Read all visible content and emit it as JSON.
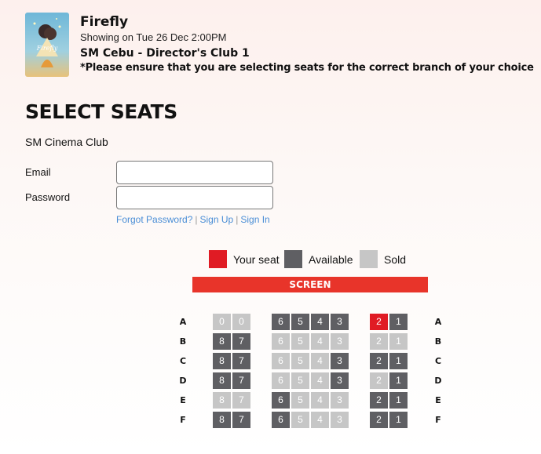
{
  "movie": {
    "title": "Firefly",
    "showing": "Showing on Tue 26 Dec 2:00PM",
    "branch": "SM Cebu - Director's Club 1",
    "warning": "*Please ensure that you are selecting seats for the correct branch of your choice",
    "poster_text": "Firefly"
  },
  "page": {
    "title": "SELECT SEATS",
    "club_label": "SM Cinema Club"
  },
  "login": {
    "email_label": "Email",
    "email_value": "",
    "password_label": "Password",
    "password_value": "",
    "forgot_label": "Forgot Password?",
    "signup_label": "Sign Up",
    "signin_label": "Sign In",
    "separator": "|"
  },
  "legend": {
    "your_seat": "Your seat",
    "available": "Available",
    "sold": "Sold"
  },
  "colors": {
    "your_seat": "#e01b24",
    "available": "#5f5f63",
    "sold": "#c6c6c6",
    "screen": "#e8342a",
    "link": "#4a8ed6"
  },
  "screen_label": "SCREEN",
  "seatmap": {
    "rows": [
      {
        "row": "A",
        "seats": [
          {
            "n": "0",
            "s": "sold"
          },
          {
            "n": "0",
            "s": "sold"
          },
          {
            "n": "6",
            "s": "available"
          },
          {
            "n": "5",
            "s": "available"
          },
          {
            "n": "4",
            "s": "available"
          },
          {
            "n": "3",
            "s": "available"
          },
          {
            "n": "2",
            "s": "selected"
          },
          {
            "n": "1",
            "s": "available"
          }
        ]
      },
      {
        "row": "B",
        "seats": [
          {
            "n": "8",
            "s": "available"
          },
          {
            "n": "7",
            "s": "available"
          },
          {
            "n": "6",
            "s": "sold"
          },
          {
            "n": "5",
            "s": "sold"
          },
          {
            "n": "4",
            "s": "sold"
          },
          {
            "n": "3",
            "s": "sold"
          },
          {
            "n": "2",
            "s": "sold"
          },
          {
            "n": "1",
            "s": "sold"
          }
        ]
      },
      {
        "row": "C",
        "seats": [
          {
            "n": "8",
            "s": "available"
          },
          {
            "n": "7",
            "s": "available"
          },
          {
            "n": "6",
            "s": "sold"
          },
          {
            "n": "5",
            "s": "sold"
          },
          {
            "n": "4",
            "s": "sold"
          },
          {
            "n": "3",
            "s": "available"
          },
          {
            "n": "2",
            "s": "available"
          },
          {
            "n": "1",
            "s": "available"
          }
        ]
      },
      {
        "row": "D",
        "seats": [
          {
            "n": "8",
            "s": "available"
          },
          {
            "n": "7",
            "s": "available"
          },
          {
            "n": "6",
            "s": "sold"
          },
          {
            "n": "5",
            "s": "sold"
          },
          {
            "n": "4",
            "s": "sold"
          },
          {
            "n": "3",
            "s": "available"
          },
          {
            "n": "2",
            "s": "sold"
          },
          {
            "n": "1",
            "s": "available"
          }
        ]
      },
      {
        "row": "E",
        "seats": [
          {
            "n": "8",
            "s": "sold"
          },
          {
            "n": "7",
            "s": "sold"
          },
          {
            "n": "6",
            "s": "available"
          },
          {
            "n": "5",
            "s": "sold"
          },
          {
            "n": "4",
            "s": "sold"
          },
          {
            "n": "3",
            "s": "sold"
          },
          {
            "n": "2",
            "s": "available"
          },
          {
            "n": "1",
            "s": "available"
          }
        ]
      },
      {
        "row": "F",
        "seats": [
          {
            "n": "8",
            "s": "available"
          },
          {
            "n": "7",
            "s": "available"
          },
          {
            "n": "6",
            "s": "available"
          },
          {
            "n": "5",
            "s": "sold"
          },
          {
            "n": "4",
            "s": "sold"
          },
          {
            "n": "3",
            "s": "sold"
          },
          {
            "n": "2",
            "s": "available"
          },
          {
            "n": "1",
            "s": "available"
          }
        ]
      }
    ]
  }
}
